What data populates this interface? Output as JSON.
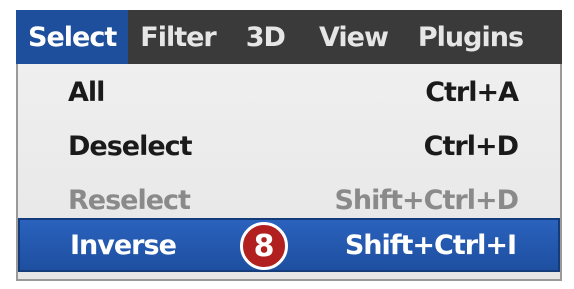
{
  "menubar": {
    "items": [
      {
        "label": "Select",
        "active": true
      },
      {
        "label": "Filter"
      },
      {
        "label": "3D"
      },
      {
        "label": "View"
      },
      {
        "label": "Plugins"
      }
    ]
  },
  "dropdown": {
    "items": [
      {
        "label": "All",
        "shortcut": "Ctrl+A",
        "enabled": true,
        "highlighted": false
      },
      {
        "label": "Deselect",
        "shortcut": "Ctrl+D",
        "enabled": true,
        "highlighted": false
      },
      {
        "label": "Reselect",
        "shortcut": "Shift+Ctrl+D",
        "enabled": false,
        "highlighted": false
      },
      {
        "label": "Inverse",
        "shortcut": "Shift+Ctrl+I",
        "enabled": true,
        "highlighted": true
      }
    ]
  },
  "step_badge": {
    "number": "8",
    "color": "#b21f1f"
  },
  "colors": {
    "menubar_bg": "#3a3a3a",
    "highlight": "#1e4fa0",
    "menu_bg": "#e8e8e8",
    "disabled_text": "#8a8a8a"
  }
}
